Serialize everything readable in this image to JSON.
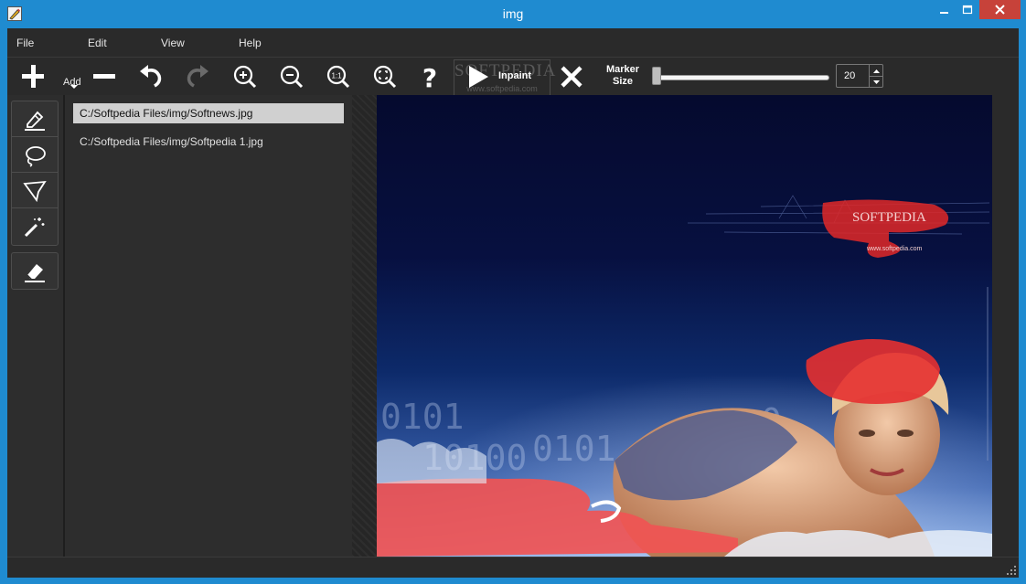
{
  "window": {
    "title": "img"
  },
  "menu": {
    "file": "File",
    "edit": "Edit",
    "view": "View",
    "help": "Help"
  },
  "toolbar": {
    "add_label": "Add",
    "inpaint_label": "Inpaint",
    "marker_size_label": "Marker Size",
    "marker_size_value": "20",
    "marker_size_level": 0.0,
    "watermark_title": "SOFTPEDIA",
    "watermark_sub": "www.softpedia.com"
  },
  "tools": [
    {
      "icon": "marker-icon"
    },
    {
      "icon": "lasso-icon"
    },
    {
      "icon": "polygon-lasso-icon"
    },
    {
      "icon": "magic-wand-icon"
    },
    {
      "icon": "eraser-icon"
    }
  ],
  "files": [
    {
      "path": "C:/Softpedia Files/img/Softnews.jpg",
      "selected": true
    },
    {
      "path": "C:/Softpedia Files/img/Softpedia 1.jpg",
      "selected": false
    }
  ],
  "canvas": {
    "logo_text": "SOFTPEDIA",
    "logo_url": "www.softpedia.com",
    "mask_color": "#ff4444"
  }
}
